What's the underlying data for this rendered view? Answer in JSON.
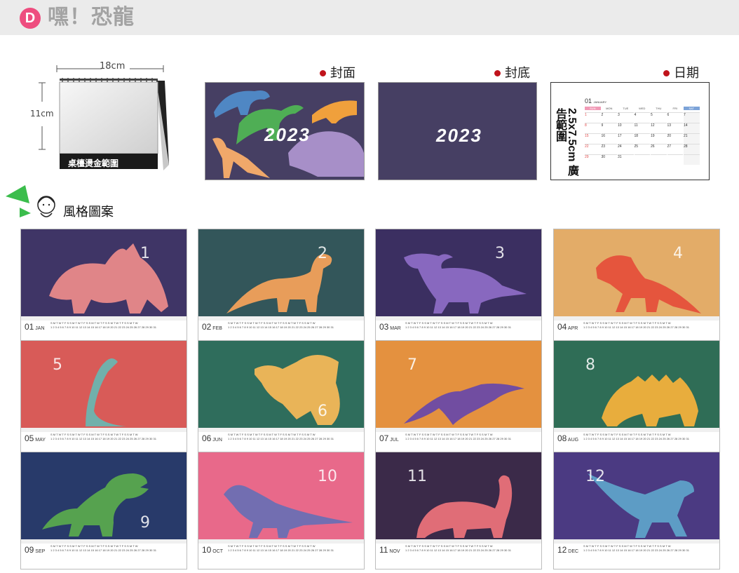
{
  "header": {
    "badge": "D",
    "title": "嘿！恐龍"
  },
  "desk": {
    "width_label": "18cm",
    "height_label": "11cm",
    "area_label": "桌檯燙金範圍"
  },
  "sections": {
    "cover": "封面",
    "back": "封底",
    "date": "日期",
    "cover_year": "2023",
    "back_year": "2023",
    "ad_label": "2.5x7.5cm 廣告範圍",
    "style_title": "風格圖案"
  },
  "sample": {
    "month_num": "01",
    "month_name": "JANUARY",
    "weekdays": [
      "SUN",
      "MON",
      "TUE",
      "WED",
      "THU",
      "FRI",
      "SAT"
    ],
    "rows": [
      [
        "1",
        "2",
        "3",
        "4",
        "5",
        "6",
        "7"
      ],
      [
        "8",
        "9",
        "10",
        "11",
        "12",
        "13",
        "14"
      ],
      [
        "15",
        "16",
        "17",
        "18",
        "19",
        "20",
        "21"
      ],
      [
        "22",
        "23",
        "24",
        "25",
        "26",
        "27",
        "28"
      ],
      [
        "29",
        "30",
        "31",
        "",
        "",
        "",
        ""
      ]
    ]
  },
  "colors": {
    "cover_bg": "#463f63",
    "badge": "#ee4d7f",
    "accent_dot": "#c0131b",
    "weekend_red": "#e14b4b"
  },
  "months": [
    {
      "num": "01",
      "abbr": "JAN",
      "digit": "1",
      "bg": "#3f3566",
      "dino": "triceratops-icon",
      "fill": "#e98a8a"
    },
    {
      "num": "02",
      "abbr": "FEB",
      "digit": "2",
      "bg": "#33565a",
      "dino": "sauropod-icon",
      "fill": "#f2a15b"
    },
    {
      "num": "03",
      "abbr": "MAR",
      "digit": "3",
      "bg": "#3b2f61",
      "dino": "parasaurolophus-icon",
      "fill": "#8c6bc4"
    },
    {
      "num": "04",
      "abbr": "APR",
      "digit": "4",
      "bg": "#e3ac68",
      "dino": "allosaurus-icon",
      "fill": "#e5503b"
    },
    {
      "num": "05",
      "abbr": "MAY",
      "digit": "5",
      "bg": "#d85b58",
      "dino": "brachiosaurus-icon",
      "fill": "#6bb5b0"
    },
    {
      "num": "06",
      "abbr": "JUN",
      "digit": "6",
      "bg": "#2f6d5c",
      "dino": "spinosaurus-icon",
      "fill": "#f3b857"
    },
    {
      "num": "07",
      "abbr": "JUL",
      "digit": "7",
      "bg": "#e4913f",
      "dino": "pterodactyl-icon",
      "fill": "#6a4aa6"
    },
    {
      "num": "08",
      "abbr": "AUG",
      "digit": "8",
      "bg": "#2f6d56",
      "dino": "stegosaurus-icon",
      "fill": "#f2b13c"
    },
    {
      "num": "09",
      "abbr": "SEP",
      "digit": "9",
      "bg": "#283a6a",
      "dino": "trex-icon",
      "fill": "#58a84e"
    },
    {
      "num": "10",
      "abbr": "OCT",
      "digit": "10",
      "bg": "#e8698a",
      "dino": "pachycephalosaurus-icon",
      "fill": "#6c6fb3"
    },
    {
      "num": "11",
      "abbr": "NOV",
      "digit": "11",
      "bg": "#3b2a49",
      "dino": "ankylosaurus-icon",
      "fill": "#e9717a"
    },
    {
      "num": "12",
      "abbr": "DEC",
      "digit": "12",
      "bg": "#4b3a82",
      "dino": "carnotaurus-icon",
      "fill": "#5ea1c8"
    }
  ]
}
